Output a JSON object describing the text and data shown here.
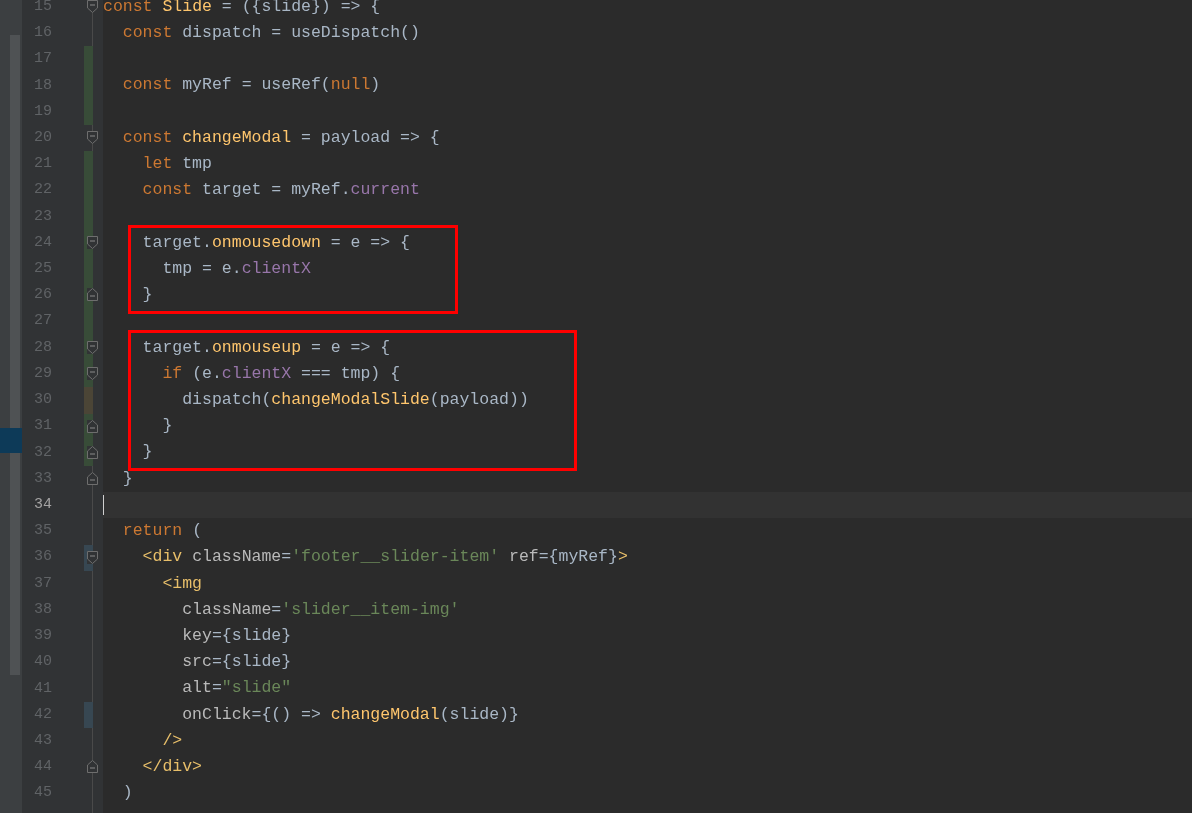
{
  "editor": {
    "blocks": [
      {
        "kind": "plain",
        "lines": [
          {
            "number": "15",
            "fold_start": true,
            "fold_end": false,
            "current": false,
            "tokens": [
              {
                "text": "const ",
                "kind": "keyword"
              },
              {
                "text": "Slide",
                "kind": "function"
              },
              {
                "text": " = ({slide}) => {",
                "kind": "plain"
              }
            ]
          },
          {
            "number": "16",
            "fold_start": false,
            "fold_end": false,
            "current": false,
            "tokens": [
              {
                "text": "  const ",
                "kind": "keyword"
              },
              {
                "text": "dispatch = useDispatch()",
                "kind": "plain"
              }
            ]
          },
          {
            "number": "17",
            "marker": {
              "color": "#384c38"
            },
            "fold_start": false,
            "fold_end": false,
            "current": false
          },
          {
            "number": "18",
            "marker": {
              "color": "#384c38"
            },
            "fold_start": false,
            "fold_end": false,
            "current": false,
            "tokens": [
              {
                "text": "  const ",
                "kind": "keyword"
              },
              {
                "text": "myRef = useRef(",
                "kind": "plain"
              },
              {
                "text": "null",
                "kind": "keyword"
              },
              {
                "text": ")",
                "kind": "plain"
              }
            ]
          },
          {
            "number": "19",
            "marker": {
              "color": "#384c38"
            },
            "fold_start": false,
            "fold_end": false,
            "current": false
          },
          {
            "number": "20",
            "fold_start": true,
            "fold_end": false,
            "current": false,
            "tokens": [
              {
                "text": "  const ",
                "kind": "keyword"
              },
              {
                "text": "changeModal",
                "kind": "function"
              },
              {
                "text": " = payload => {",
                "kind": "plain"
              }
            ]
          },
          {
            "number": "21",
            "marker": {
              "color": "#384c38"
            },
            "fold_start": false,
            "fold_end": false,
            "current": false,
            "tokens": [
              {
                "text": "    let ",
                "kind": "keyword"
              },
              {
                "text": "tmp",
                "kind": "plain"
              }
            ]
          },
          {
            "number": "22",
            "marker": {
              "color": "#384c38"
            },
            "fold_start": false,
            "fold_end": false,
            "current": false,
            "tokens": [
              {
                "text": "    const ",
                "kind": "keyword"
              },
              {
                "text": "target = myRef.",
                "kind": "plain"
              },
              {
                "text": "current",
                "kind": "field"
              }
            ]
          },
          {
            "number": "23",
            "marker": {
              "color": "#384c38"
            },
            "fold_start": false,
            "fold_end": false,
            "current": false
          }
        ]
      },
      {
        "kind": "boxed",
        "lines": [
          {
            "number": "24",
            "marker": {
              "color": "#384c38"
            },
            "fold_start": true,
            "fold_end": false,
            "current": false,
            "tokens": [
              {
                "text": "    target.",
                "kind": "plain"
              },
              {
                "text": "onmousedown",
                "kind": "function"
              },
              {
                "text": " = e => {",
                "kind": "plain"
              }
            ]
          },
          {
            "number": "25",
            "marker": {
              "color": "#384c38"
            },
            "fold_start": false,
            "fold_end": false,
            "current": false,
            "tokens": [
              {
                "text": "      tmp = e.",
                "kind": "plain"
              },
              {
                "text": "clientX",
                "kind": "field"
              }
            ]
          },
          {
            "number": "26",
            "marker": {
              "color": "#384c38"
            },
            "fold_start": false,
            "fold_end": true,
            "current": false,
            "tokens": [
              {
                "text": "    }",
                "kind": "plain"
              }
            ]
          }
        ]
      },
      {
        "kind": "plain",
        "lines": [
          {
            "number": "27",
            "marker": {
              "color": "#384c38"
            },
            "fold_start": false,
            "fold_end": false,
            "current": false
          }
        ]
      },
      {
        "kind": "boxed",
        "lines": [
          {
            "number": "28",
            "marker": {
              "color": "#384c38"
            },
            "fold_start": true,
            "fold_end": false,
            "current": false,
            "tokens": [
              {
                "text": "    target.",
                "kind": "plain"
              },
              {
                "text": "onmouseup",
                "kind": "function"
              },
              {
                "text": " = e => {",
                "kind": "plain"
              }
            ]
          },
          {
            "number": "29",
            "marker": {
              "color": "#384c38"
            },
            "fold_start": true,
            "fold_end": false,
            "current": false,
            "tokens": [
              {
                "text": "      if ",
                "kind": "keyword"
              },
              {
                "text": "(e.",
                "kind": "plain"
              },
              {
                "text": "clientX",
                "kind": "field"
              },
              {
                "text": " === tmp) {",
                "kind": "plain"
              }
            ]
          },
          {
            "number": "30",
            "marker": {
              "color": "#4b4536"
            },
            "fold_start": false,
            "fold_end": false,
            "current": false,
            "tokens": [
              {
                "text": "        dispatch(",
                "kind": "plain"
              },
              {
                "text": "changeModalSlide",
                "kind": "function"
              },
              {
                "text": "(payload))",
                "kind": "plain"
              }
            ]
          },
          {
            "number": "31",
            "marker": {
              "color": "#384c38"
            },
            "fold_start": false,
            "fold_end": true,
            "current": false,
            "tokens": [
              {
                "text": "      }",
                "kind": "plain"
              }
            ]
          },
          {
            "number": "32",
            "marker": {
              "color": "#384c38"
            },
            "fold_start": false,
            "fold_end": true,
            "current": false,
            "tokens": [
              {
                "text": "    }",
                "kind": "plain"
              }
            ]
          }
        ]
      },
      {
        "kind": "plain",
        "lines": [
          {
            "number": "33",
            "fold_start": false,
            "fold_end": true,
            "current": false,
            "tokens": [
              {
                "text": "  }",
                "kind": "plain"
              }
            ]
          },
          {
            "number": "34",
            "fold_start": false,
            "fold_end": false,
            "current": true
          },
          {
            "number": "35",
            "fold_start": false,
            "fold_end": false,
            "current": false,
            "tokens": [
              {
                "text": "  return ",
                "kind": "keyword"
              },
              {
                "text": "(",
                "kind": "plain"
              }
            ]
          },
          {
            "number": "36",
            "marker": {
              "color": "#374752"
            },
            "fold_start": true,
            "fold_end": false,
            "current": false,
            "tokens": [
              {
                "text": "    <div ",
                "kind": "tag"
              },
              {
                "text": "className",
                "kind": "attribute"
              },
              {
                "text": "=",
                "kind": "plain"
              },
              {
                "text": "'footer__slider-item'",
                "kind": "string"
              },
              {
                "text": " ref",
                "kind": "attribute"
              },
              {
                "text": "={myRef}",
                "kind": "plain"
              },
              {
                "text": ">",
                "kind": "tag"
              }
            ]
          },
          {
            "number": "37",
            "fold_start": false,
            "fold_end": false,
            "current": false,
            "tokens": [
              {
                "text": "      <img",
                "kind": "tag"
              }
            ]
          },
          {
            "number": "38",
            "fold_start": false,
            "fold_end": false,
            "current": false,
            "tokens": [
              {
                "text": "        className",
                "kind": "attribute"
              },
              {
                "text": "=",
                "kind": "plain"
              },
              {
                "text": "'slider__item-img'",
                "kind": "string"
              }
            ]
          },
          {
            "number": "39",
            "fold_start": false,
            "fold_end": false,
            "current": false,
            "tokens": [
              {
                "text": "        key",
                "kind": "attribute"
              },
              {
                "text": "={slide}",
                "kind": "plain"
              }
            ]
          },
          {
            "number": "40",
            "fold_start": false,
            "fold_end": false,
            "current": false,
            "tokens": [
              {
                "text": "        src",
                "kind": "attribute"
              },
              {
                "text": "={slide}",
                "kind": "plain"
              }
            ]
          },
          {
            "number": "41",
            "fold_start": false,
            "fold_end": false,
            "current": false,
            "tokens": [
              {
                "text": "        alt",
                "kind": "attribute"
              },
              {
                "text": "=",
                "kind": "plain"
              },
              {
                "text": "\"slide\"",
                "kind": "string"
              }
            ]
          },
          {
            "number": "42",
            "marker": {
              "color": "#374752"
            },
            "fold_start": false,
            "fold_end": false,
            "current": false,
            "tokens": [
              {
                "text": "        onClick",
                "kind": "attribute"
              },
              {
                "text": "={() => ",
                "kind": "plain"
              },
              {
                "text": "changeModal",
                "kind": "function"
              },
              {
                "text": "(slide)}",
                "kind": "plain"
              }
            ]
          },
          {
            "number": "43",
            "fold_start": false,
            "fold_end": false,
            "current": false,
            "tokens": [
              {
                "text": "      />",
                "kind": "tag"
              }
            ]
          },
          {
            "number": "44",
            "fold_start": false,
            "fold_end": true,
            "current": false,
            "tokens": [
              {
                "text": "    </div>",
                "kind": "tag"
              }
            ]
          },
          {
            "number": "45",
            "fold_start": false,
            "fold_end": false,
            "current": false,
            "tokens": [
              {
                "text": "  )",
                "kind": "plain"
              }
            ]
          }
        ]
      }
    ]
  }
}
